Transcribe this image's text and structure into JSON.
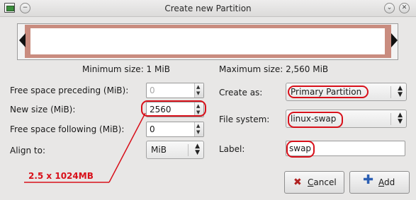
{
  "window": {
    "title": "Create new Partition"
  },
  "sizes": {
    "minimum": "Minimum size: 1 MiB",
    "maximum": "Maximum size: 2,560 MiB"
  },
  "form_left": {
    "free_preceding_label": "Free space preceding (MiB):",
    "free_preceding_value": "0",
    "new_size_label": "New size (MiB):",
    "new_size_value": "2560",
    "free_following_label": "Free space following (MiB):",
    "free_following_value": "0",
    "align_label": "Align to:",
    "align_value": "MiB"
  },
  "form_right": {
    "create_as_label": "Create as:",
    "create_as_value": "Primary Partition",
    "file_system_label": "File system:",
    "file_system_value": "linux-swap",
    "label_label": "Label:",
    "label_value": "swap"
  },
  "buttons": {
    "cancel_prefix": "",
    "cancel_mnemonic": "C",
    "cancel_rest": "ancel",
    "add_mnemonic": "A",
    "add_rest": "dd"
  },
  "annotation": {
    "text": "2.5 x 1024MB",
    "color": "#d8101a"
  },
  "icons": {
    "window_icon": "gparted-window-icon",
    "cancel_icon": "cancel-x-icon",
    "add_icon": "add-plus-icon"
  }
}
